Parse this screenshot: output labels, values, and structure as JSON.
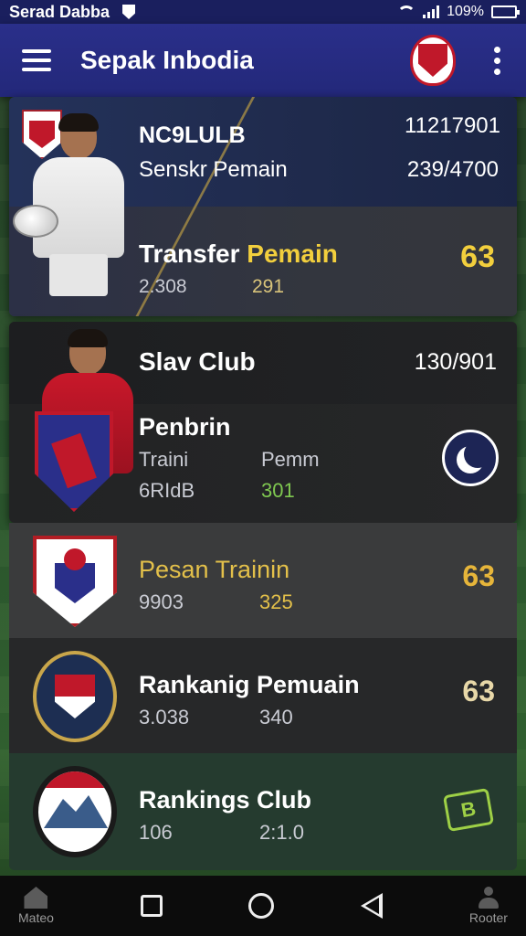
{
  "status_bar": {
    "title": "Serad Dabba",
    "battery": "109%",
    "battery_level": 1.0,
    "icons": [
      "shield-icon",
      "wifi-icon",
      "signal-icon",
      "battery-icon"
    ]
  },
  "app_bar": {
    "title": "Sepak Inbodia",
    "icons": [
      "menu-icon",
      "club-logo",
      "more-vert-icon"
    ]
  },
  "card_featured": {
    "club": "NC9LULB",
    "subtitle": "Senskr Pemain",
    "num_top": "11217901",
    "num_ratio": "239/4700",
    "title_part1": "Transfer",
    "title_part2": "Pemain",
    "stat_left": "2.308",
    "stat_right": "291",
    "score": "63"
  },
  "card_club": {
    "club": "Slav Club",
    "num": "130/901",
    "title": "Penbrin",
    "row1_left": "Traini",
    "row1_right": "Pemm",
    "row2_left": "6RIdB",
    "row2_right": "301",
    "icon": "moon-icon"
  },
  "rows": [
    {
      "title": "Pesan Trainin",
      "stat_left": "9903",
      "stat_right": "325",
      "score": "63",
      "crest": "shield-crest"
    },
    {
      "title": "Rankanig Pemuain",
      "stat_left": "3.038",
      "stat_right": "340",
      "score": "63",
      "crest": "circle-crest"
    },
    {
      "title": "Rankings Club",
      "stat_left": "106",
      "stat_right": "2:1.0",
      "score": "",
      "crest": "mountain-crest",
      "icon": "bill-icon"
    }
  ],
  "nav": {
    "home_label": "Mateo",
    "profile_label": "Rooter"
  },
  "colors": {
    "status_bar": "#1a1f5e",
    "app_bar": "#2a2f8a",
    "accent_gold": "#f2cf3d",
    "accent_green": "#7fc850",
    "crest_red": "#c0182a"
  }
}
